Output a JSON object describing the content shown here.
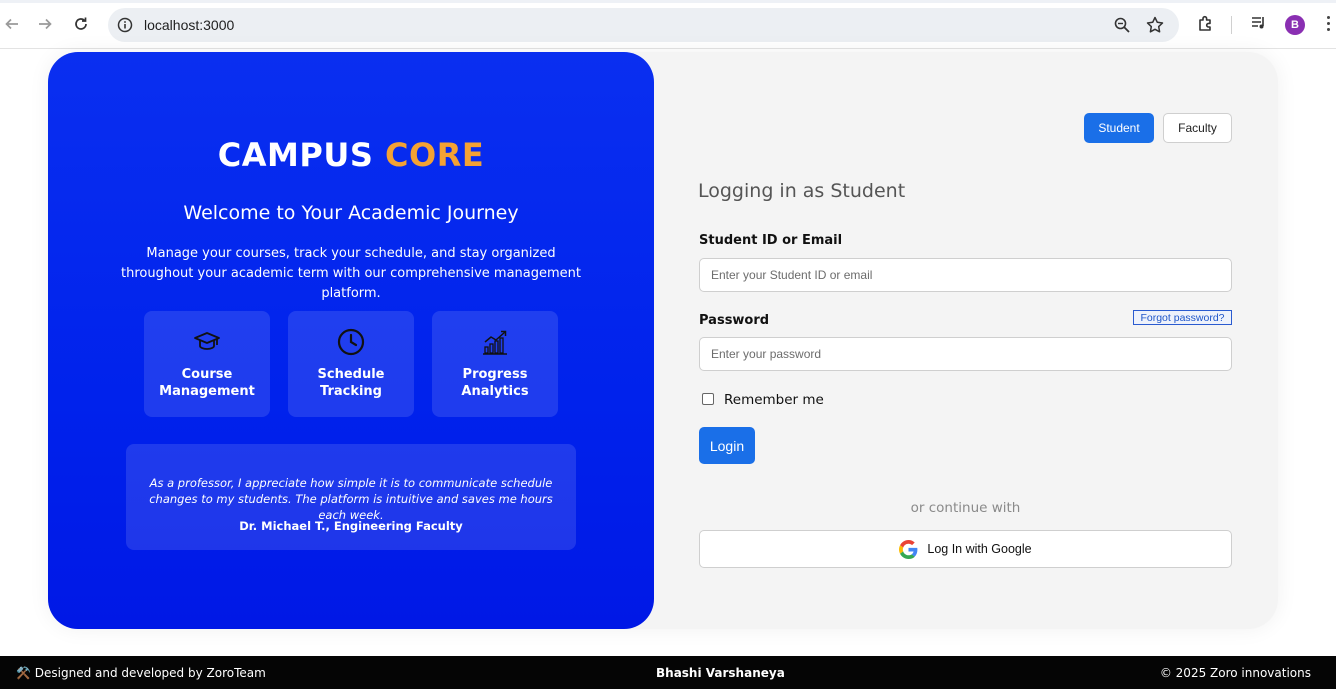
{
  "browser": {
    "url": "localhost:3000",
    "profile_initial": "B",
    "icons": [
      "back-icon",
      "forward-icon",
      "reload-icon",
      "site-info-icon",
      "zoom-icon",
      "bookmark-star-icon",
      "extensions-icon",
      "media-icon",
      "menu-icon"
    ]
  },
  "hero": {
    "brand_primary": "CAMPUS",
    "brand_accent": "CORE",
    "welcome": "Welcome to Your Academic Journey",
    "description": "Manage your courses, track your schedule, and stay organized throughout your academic term with our comprehensive management platform.",
    "features": [
      {
        "label": "Course\nManagement",
        "icon": "graduation-cap-icon"
      },
      {
        "label": "Schedule\nTracking",
        "icon": "clock-icon"
      },
      {
        "label": "Progress\nAnalytics",
        "icon": "chart-icon"
      }
    ],
    "testimonial": {
      "quote": "As a professor, I appreciate how simple it is to communicate schedule changes to my students. The platform is intuitive and saves me hours each week.",
      "author": "Dr. Michael T., Engineering Faculty"
    },
    "colors": {
      "background": "#0022ec",
      "accent": "#f4a233"
    }
  },
  "form": {
    "roles": [
      "Student",
      "Faculty"
    ],
    "selected_role": "Student",
    "heading": "Logging in as Student",
    "id_label": "Student ID or Email",
    "id_placeholder": "Enter your Student ID or email",
    "password_label": "Password",
    "password_placeholder": "Enter your password",
    "forgot_label": "Forgot password?",
    "remember_label": "Remember me",
    "remember_checked": false,
    "login_label": "Login",
    "divider_text": "or continue with",
    "google_label": "Log In with Google",
    "colors": {
      "primary": "#1a6fe8"
    }
  },
  "footer": {
    "left": "⚒️ Designed and developed by ZoroTeam",
    "center": "Bhashi Varshaneya",
    "right": "© 2025 Zoro innovations"
  }
}
